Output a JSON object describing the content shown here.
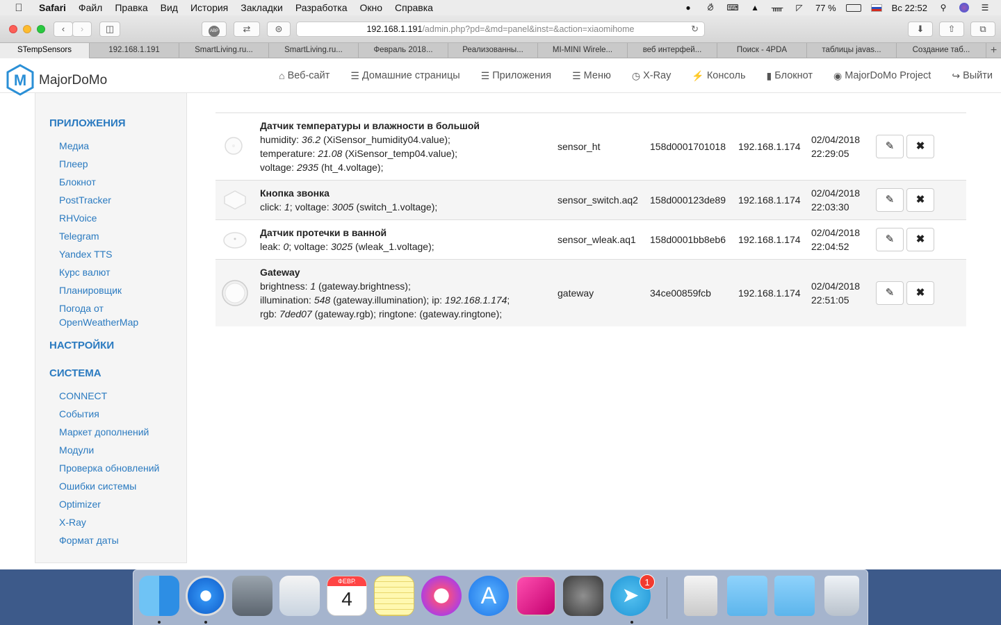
{
  "menubar": {
    "app": "Safari",
    "items": [
      "Файл",
      "Правка",
      "Вид",
      "История",
      "Закладки",
      "Разработка",
      "Окно",
      "Справка"
    ],
    "battery": "77 %",
    "clock": "Вс 22:52"
  },
  "browser": {
    "url_host": "192.168.1.191",
    "url_path": "/admin.php?pd=&md=panel&inst=&action=xiaomihome",
    "tabs": [
      "STempSensors",
      "192.168.1.191",
      "SmartLiving.ru...",
      "SmartLiving.ru...",
      "Февраль 2018...",
      "Реализованны...",
      "MI-MINI Wirele...",
      "веб интерфей...",
      "Поиск - 4PDA",
      "таблицы javas...",
      "Создание таб..."
    ],
    "abp_label": "ABP"
  },
  "navbar": {
    "brand": "MajorDoMo",
    "links": [
      "Веб-сайт",
      "Домашние страницы",
      "Приложения",
      "Меню",
      "X-Ray",
      "Консоль",
      "Блокнот",
      "MajorDoMo Project",
      "Выйти"
    ]
  },
  "sidebar": {
    "section_apps": "ПРИЛОЖЕНИЯ",
    "apps": [
      "Медиа",
      "Плеер",
      "Блокнот",
      "PostTracker",
      "RHVoice",
      "Telegram",
      "Yandex TTS",
      "Курс валют",
      "Планировщик",
      "Погода от",
      "OpenWeatherMap"
    ],
    "section_settings": "НАСТРОЙКИ",
    "section_system": "СИСТЕМА",
    "system": [
      "CONNECT",
      "События",
      "Маркет дополнений",
      "Модули",
      "Проверка обновлений",
      "Ошибки системы",
      "Optimizer",
      "X-Ray",
      "Формат даты"
    ]
  },
  "devices": [
    {
      "title": "Датчик температуры и влажности в большой",
      "lines": [
        {
          "k": "humidity: ",
          "v": "36.2",
          "s": " (XiSensor_humidity04.value);"
        },
        {
          "k": "temperature: ",
          "v": "21.08",
          "s": " (XiSensor_temp04.value);"
        },
        {
          "k": "voltage: ",
          "v": "2935",
          "s": " (ht_4.voltage);"
        }
      ],
      "type": "sensor_ht",
      "sid": "158d0001701018",
      "ip": "192.168.1.174",
      "date": "02/04/2018",
      "time": "22:29:05"
    },
    {
      "title": "Кнопка звонка",
      "lines": [
        {
          "k": "click: ",
          "v": "1",
          "s": "; voltage: ",
          "v2": "3005",
          "s2": " (switch_1.voltage);"
        }
      ],
      "type": "sensor_switch.aq2",
      "sid": "158d000123de89",
      "ip": "192.168.1.174",
      "date": "02/04/2018",
      "time": "22:03:30"
    },
    {
      "title": "Датчик протечки в ванной",
      "lines": [
        {
          "k": "leak: ",
          "v": "0",
          "s": "; voltage: ",
          "v2": "3025",
          "s2": " (wleak_1.voltage);"
        }
      ],
      "type": "sensor_wleak.aq1",
      "sid": "158d0001bb8eb6",
      "ip": "192.168.1.174",
      "date": "02/04/2018",
      "time": "22:04:52"
    },
    {
      "title": "Gateway",
      "lines": [
        {
          "k": "brightness: ",
          "v": "1",
          "s": " (gateway.brightness);"
        },
        {
          "k": "illumination: ",
          "v": "548",
          "s": " (gateway.illumination); ip: ",
          "v2": "192.168.1.174",
          "s2": ";"
        },
        {
          "k": "rgb: ",
          "v": "7ded07",
          "s": " (gateway.rgb); ringtone: (gateway.ringtone);"
        }
      ],
      "type": "gateway",
      "sid": "34ce00859fcb",
      "ip": "192.168.1.174",
      "date": "02/04/2018",
      "time": "22:51:05"
    }
  ],
  "dock": {
    "calendar_month": "ФЕВР.",
    "calendar_day": "4",
    "telegram_badge": "1"
  },
  "colors": {
    "link": "#2a7ac0",
    "alt_row": "#f5f5f5"
  }
}
